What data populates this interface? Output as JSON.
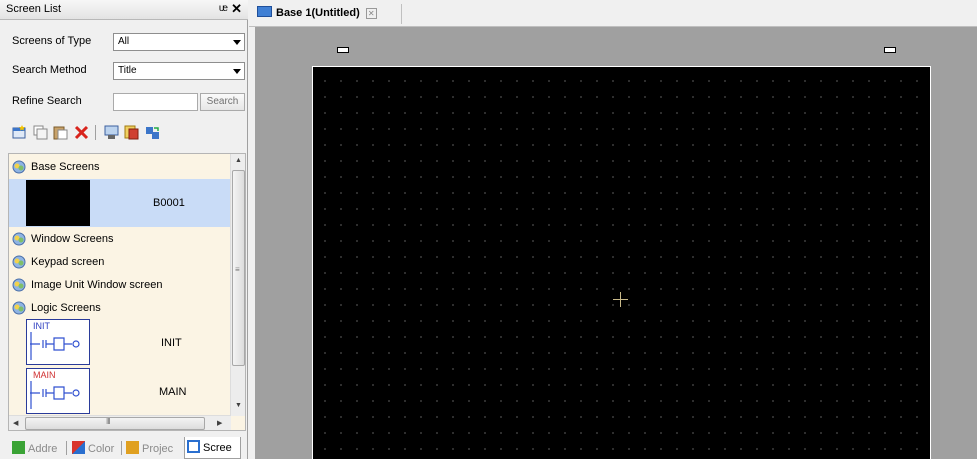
{
  "panel": {
    "title": "Screen List",
    "pin_glyph": "Ș",
    "close_glyph": "✕"
  },
  "filters": {
    "screens_of_type_label": "Screens of Type",
    "screens_of_type_value": "All",
    "search_method_label": "Search Method",
    "search_method_value": "Title",
    "refine_search_label": "Refine Search",
    "refine_search_value": "",
    "search_button": "Search"
  },
  "toolbar": {
    "icons": [
      "new-screen-icon",
      "copy-screen-icon",
      "paste-screen-icon",
      "delete-screen-icon",
      "save-screen-icon",
      "properties-icon",
      "import-icon"
    ]
  },
  "screen_list": {
    "groups": [
      {
        "label": "Base Screens",
        "icon": "screen-group-icon"
      },
      {
        "label": "Window Screens",
        "icon": "screen-group-icon"
      },
      {
        "label": "Keypad screen",
        "icon": "screen-group-icon"
      },
      {
        "label": "Image Unit Window screen",
        "icon": "screen-group-icon"
      },
      {
        "label": "Logic Screens",
        "icon": "screen-group-icon"
      }
    ],
    "base_items": [
      {
        "label": "B0001"
      }
    ],
    "logic_items": [
      {
        "label": "INIT",
        "thumb_label": "INIT"
      },
      {
        "label": "MAIN",
        "thumb_label": "MAIN"
      }
    ],
    "scroll_grip": "≡",
    "hscroll_grip": "III"
  },
  "bottom_tabs": [
    {
      "label": "Addre",
      "color": "#3aa335"
    },
    {
      "label": "Color",
      "color": "#d9342b"
    },
    {
      "label": "Projec",
      "color": "#e0a020"
    },
    {
      "label": "Scree",
      "color": "#2a6fcf"
    }
  ],
  "editor": {
    "tab_label": "Base 1(Untitled)",
    "tab_close_glyph": "✕",
    "canvas_color": "#000000",
    "workspace_color": "#a0a0a0"
  },
  "colors": {
    "selected_row": "#c9dcf7",
    "list_background": "#fbf4e4"
  }
}
